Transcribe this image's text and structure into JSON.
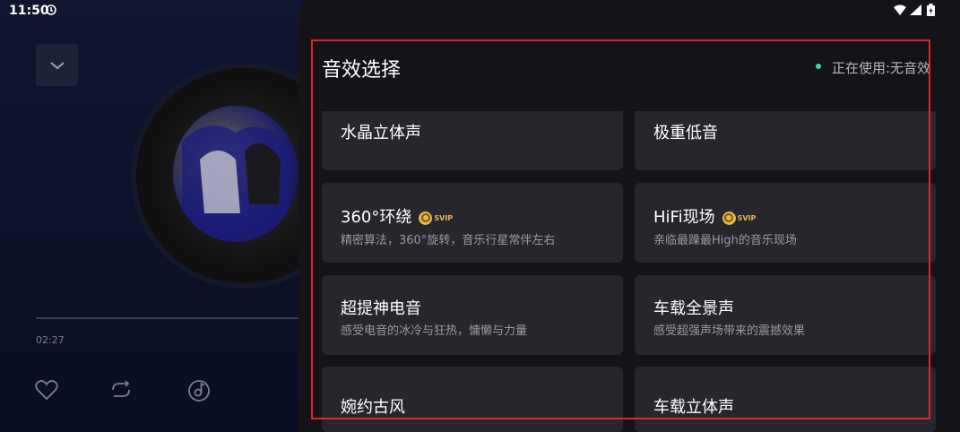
{
  "status_bar": {
    "time": "11:50"
  },
  "player": {
    "elapsed_time": "02:27"
  },
  "sheet": {
    "title": "音效选择",
    "status": "正在使用:无音效",
    "status_color": "#3dd6a0"
  },
  "svip_badge": "SVIP",
  "effects": [
    {
      "title": "水晶立体声",
      "desc": ""
    },
    {
      "title": "极重低音",
      "desc": ""
    },
    {
      "title": "360°环绕",
      "desc": "精密算法，360°旋转，音乐行星常伴左右",
      "svip": true
    },
    {
      "title": "HiFi现场",
      "desc": "亲临最躁最High的音乐现场",
      "svip": true
    },
    {
      "title": "超提神电音",
      "desc": "感受电音的冰冷与狂热，慵懒与力量"
    },
    {
      "title": "车载全景声",
      "desc": "感受超强声场带来的震撼效果"
    },
    {
      "title": "婉约古风",
      "desc": ""
    },
    {
      "title": "车载立体声",
      "desc": ""
    }
  ]
}
